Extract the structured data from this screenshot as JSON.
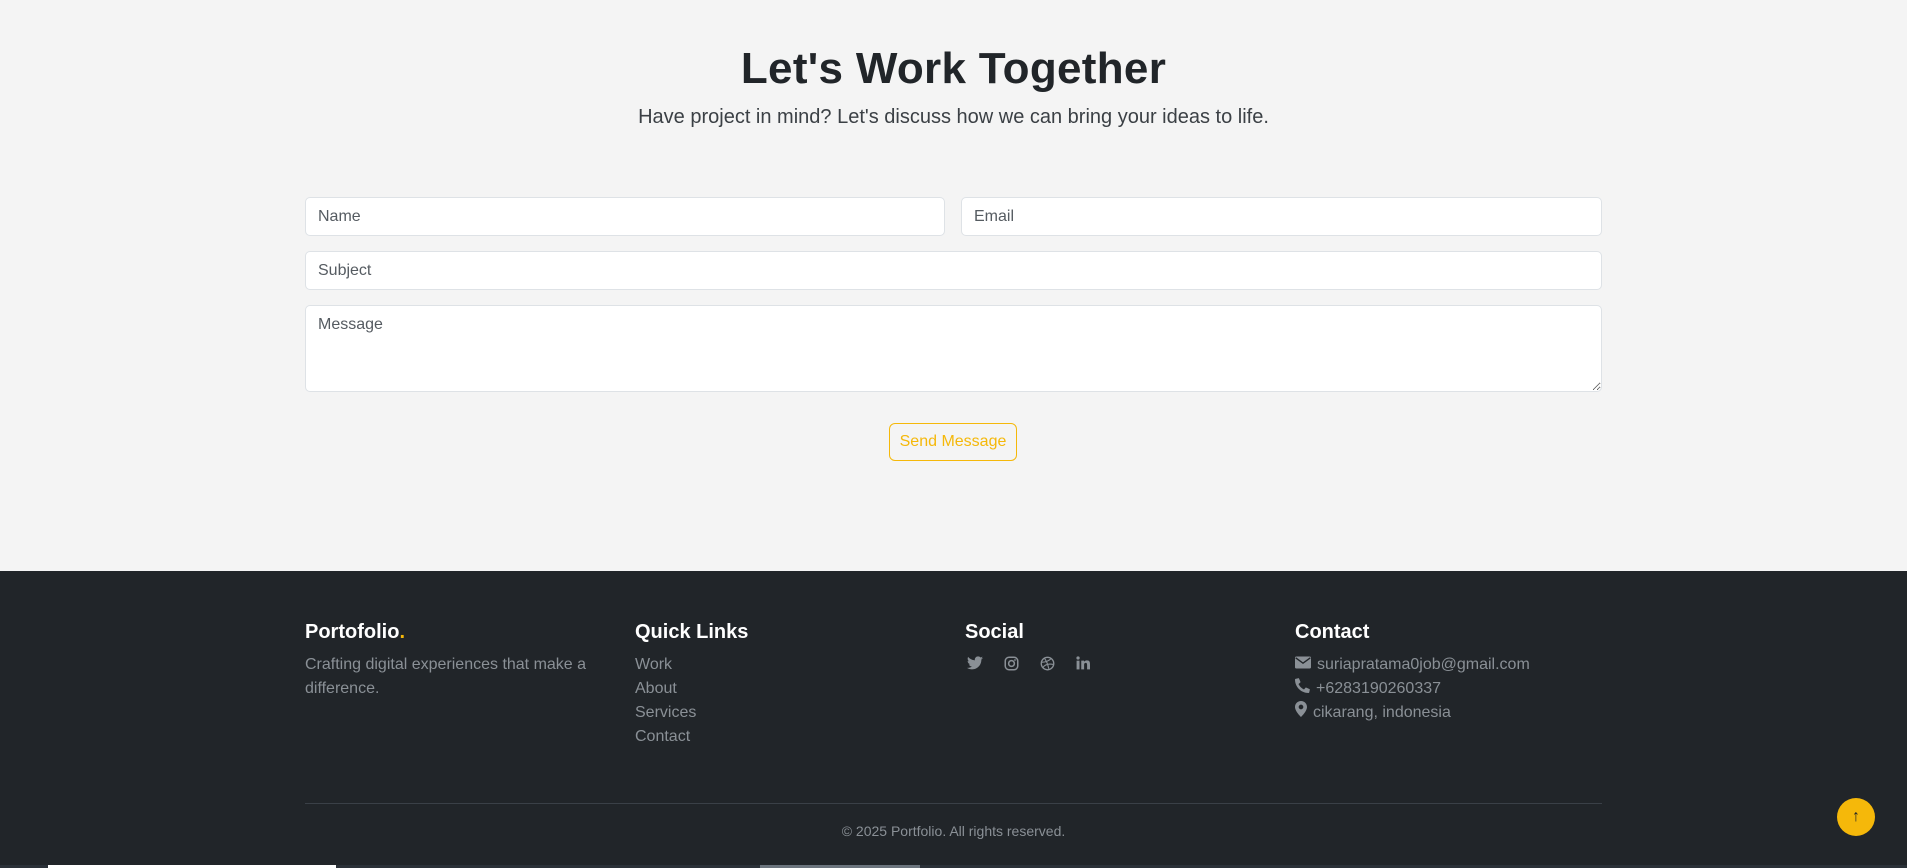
{
  "contact": {
    "title": "Let's Work Together",
    "subtitle": "Have project in mind? Let's discuss how we can bring your ideas to life.",
    "form": {
      "name_placeholder": "Name",
      "email_placeholder": "Email",
      "subject_placeholder": "Subject",
      "message_placeholder": "Message",
      "submit_label": "Send Message"
    }
  },
  "footer": {
    "brand": {
      "name": "Portofolio",
      "dot": ".",
      "tagline": "Crafting digital experiences that make a difference."
    },
    "quick_links": {
      "heading": "Quick Links",
      "items": [
        "Work",
        "About",
        "Services",
        "Contact"
      ]
    },
    "social": {
      "heading": "Social",
      "icons": [
        "twitter-icon",
        "instagram-icon",
        "dribbble-icon",
        "linkedin-icon"
      ]
    },
    "contact": {
      "heading": "Contact",
      "email": "suriapratama0job@gmail.com",
      "phone": "+6283190260337",
      "location": "cikarang, indonesia"
    },
    "copyright": "© 2025 Portfolio. All rights reserved."
  },
  "back_to_top": {
    "label": "↑"
  },
  "colors": {
    "accent": "#f5b80a",
    "footer_bg": "#212529",
    "page_bg": "#f4f4f4",
    "muted_text": "#8a9096"
  }
}
